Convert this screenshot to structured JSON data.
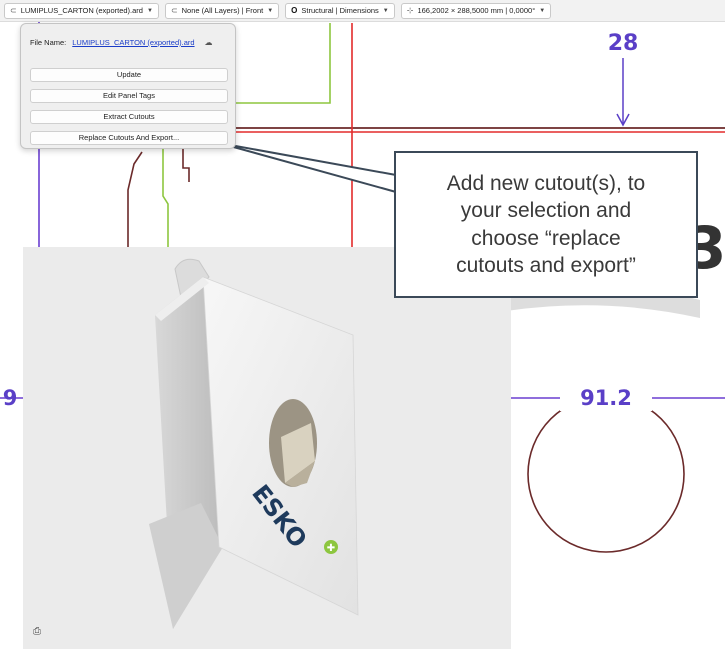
{
  "toolbar": {
    "file_dropdown": "LUMIPLUS_CARTON (exported).ard",
    "layers_dropdown": "None (All Layers) | Front",
    "view_dropdown": "Structural | Dimensions",
    "size_readout": "166,2002 × 288,5000 mm | 0,0000°"
  },
  "panel": {
    "file_name_label": "File Name:",
    "file_name_value": "LUMIPLUS_CARTON (exported).ard",
    "buttons": [
      "Update",
      "Edit Panel Tags",
      "Extract Cutouts",
      "Replace Cutouts And Export..."
    ]
  },
  "callout": {
    "text": "Add new cutout(s), to\nyour selection and\nchoose “replace\ncutouts and export”"
  },
  "drawing": {
    "dim_top": "28",
    "dim_circle": "91.2",
    "dim_left": "9",
    "partial_large_text": "3"
  },
  "viewer": {
    "brand_text": "ESKO"
  },
  "colors": {
    "structural_red": "#e32b2b",
    "dimension_purple": "#5a3fc7",
    "cut_brown": "#6b2a2a",
    "crease_green": "#8dc63f",
    "callout_border": "#3b4958"
  }
}
